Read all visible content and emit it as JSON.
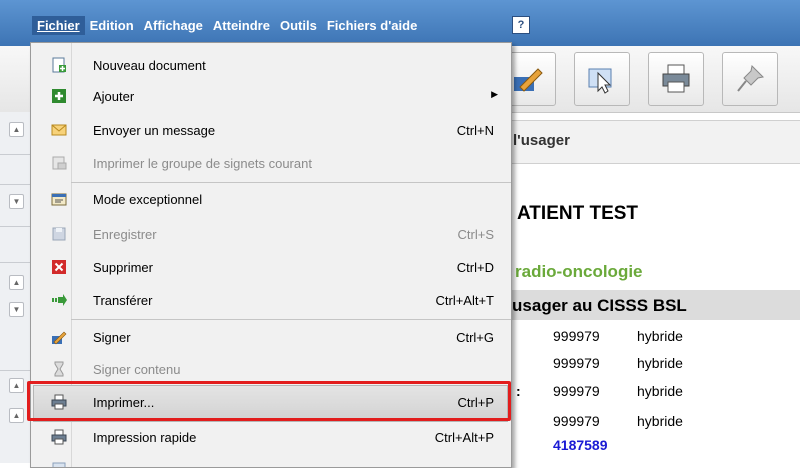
{
  "menubar": {
    "items": [
      "Fichier",
      "Edition",
      "Affichage",
      "Atteindre",
      "Outils",
      "Fichiers d'aide"
    ],
    "help_icon": "help-icon"
  },
  "toolbar": {
    "buttons": [
      "sign-pen-icon",
      "select-arrow-icon",
      "printer-icon",
      "pin-icon"
    ]
  },
  "background": {
    "header_title": "l'usager",
    "patient": "ATIENT TEST",
    "department": "radio-oncologie",
    "cisss": "'usager au CISSS BSL",
    "rows": [
      {
        "num": "999979",
        "type": "hybride"
      },
      {
        "num": "999979",
        "type": "hybride"
      },
      {
        "num": "999979",
        "type": "hybride"
      },
      {
        "num": "999979",
        "type": "hybride"
      }
    ],
    "colon": ":",
    "blue_number": "4187589"
  },
  "file_menu": {
    "items": [
      {
        "label": "Nouveau document",
        "shortcut": "",
        "disabled": false,
        "icon": "new-document-icon"
      },
      {
        "label": "Ajouter",
        "shortcut": "",
        "disabled": false,
        "icon": "add-icon",
        "submenu": true
      },
      {
        "label": "Envoyer un message",
        "shortcut": "Ctrl+N",
        "disabled": false,
        "icon": "envelope-icon"
      },
      {
        "label": "Imprimer le groupe de signets courant",
        "shortcut": "",
        "disabled": true,
        "icon": "print-bookmarks-icon"
      },
      {
        "label": "Mode exceptionnel",
        "shortcut": "",
        "disabled": false,
        "icon": "exceptional-mode-icon"
      },
      {
        "label": "Enregistrer",
        "shortcut": "Ctrl+S",
        "disabled": true,
        "icon": "save-icon"
      },
      {
        "label": "Supprimer",
        "shortcut": "Ctrl+D",
        "disabled": false,
        "icon": "delete-icon"
      },
      {
        "label": "Transférer",
        "shortcut": "Ctrl+Alt+T",
        "disabled": false,
        "icon": "transfer-icon"
      },
      {
        "label": "Signer",
        "shortcut": "Ctrl+G",
        "disabled": false,
        "icon": "sign-icon"
      },
      {
        "label": "Signer contenu",
        "shortcut": "",
        "disabled": true,
        "icon": "hourglass-icon"
      },
      {
        "label": "Imprimer...",
        "shortcut": "Ctrl+P",
        "disabled": false,
        "icon": "printer-icon",
        "highlighted": true
      },
      {
        "label": "Impression rapide",
        "shortcut": "Ctrl+Alt+P",
        "disabled": false,
        "icon": "quick-print-icon"
      }
    ],
    "submenu_arrow": "▶"
  }
}
